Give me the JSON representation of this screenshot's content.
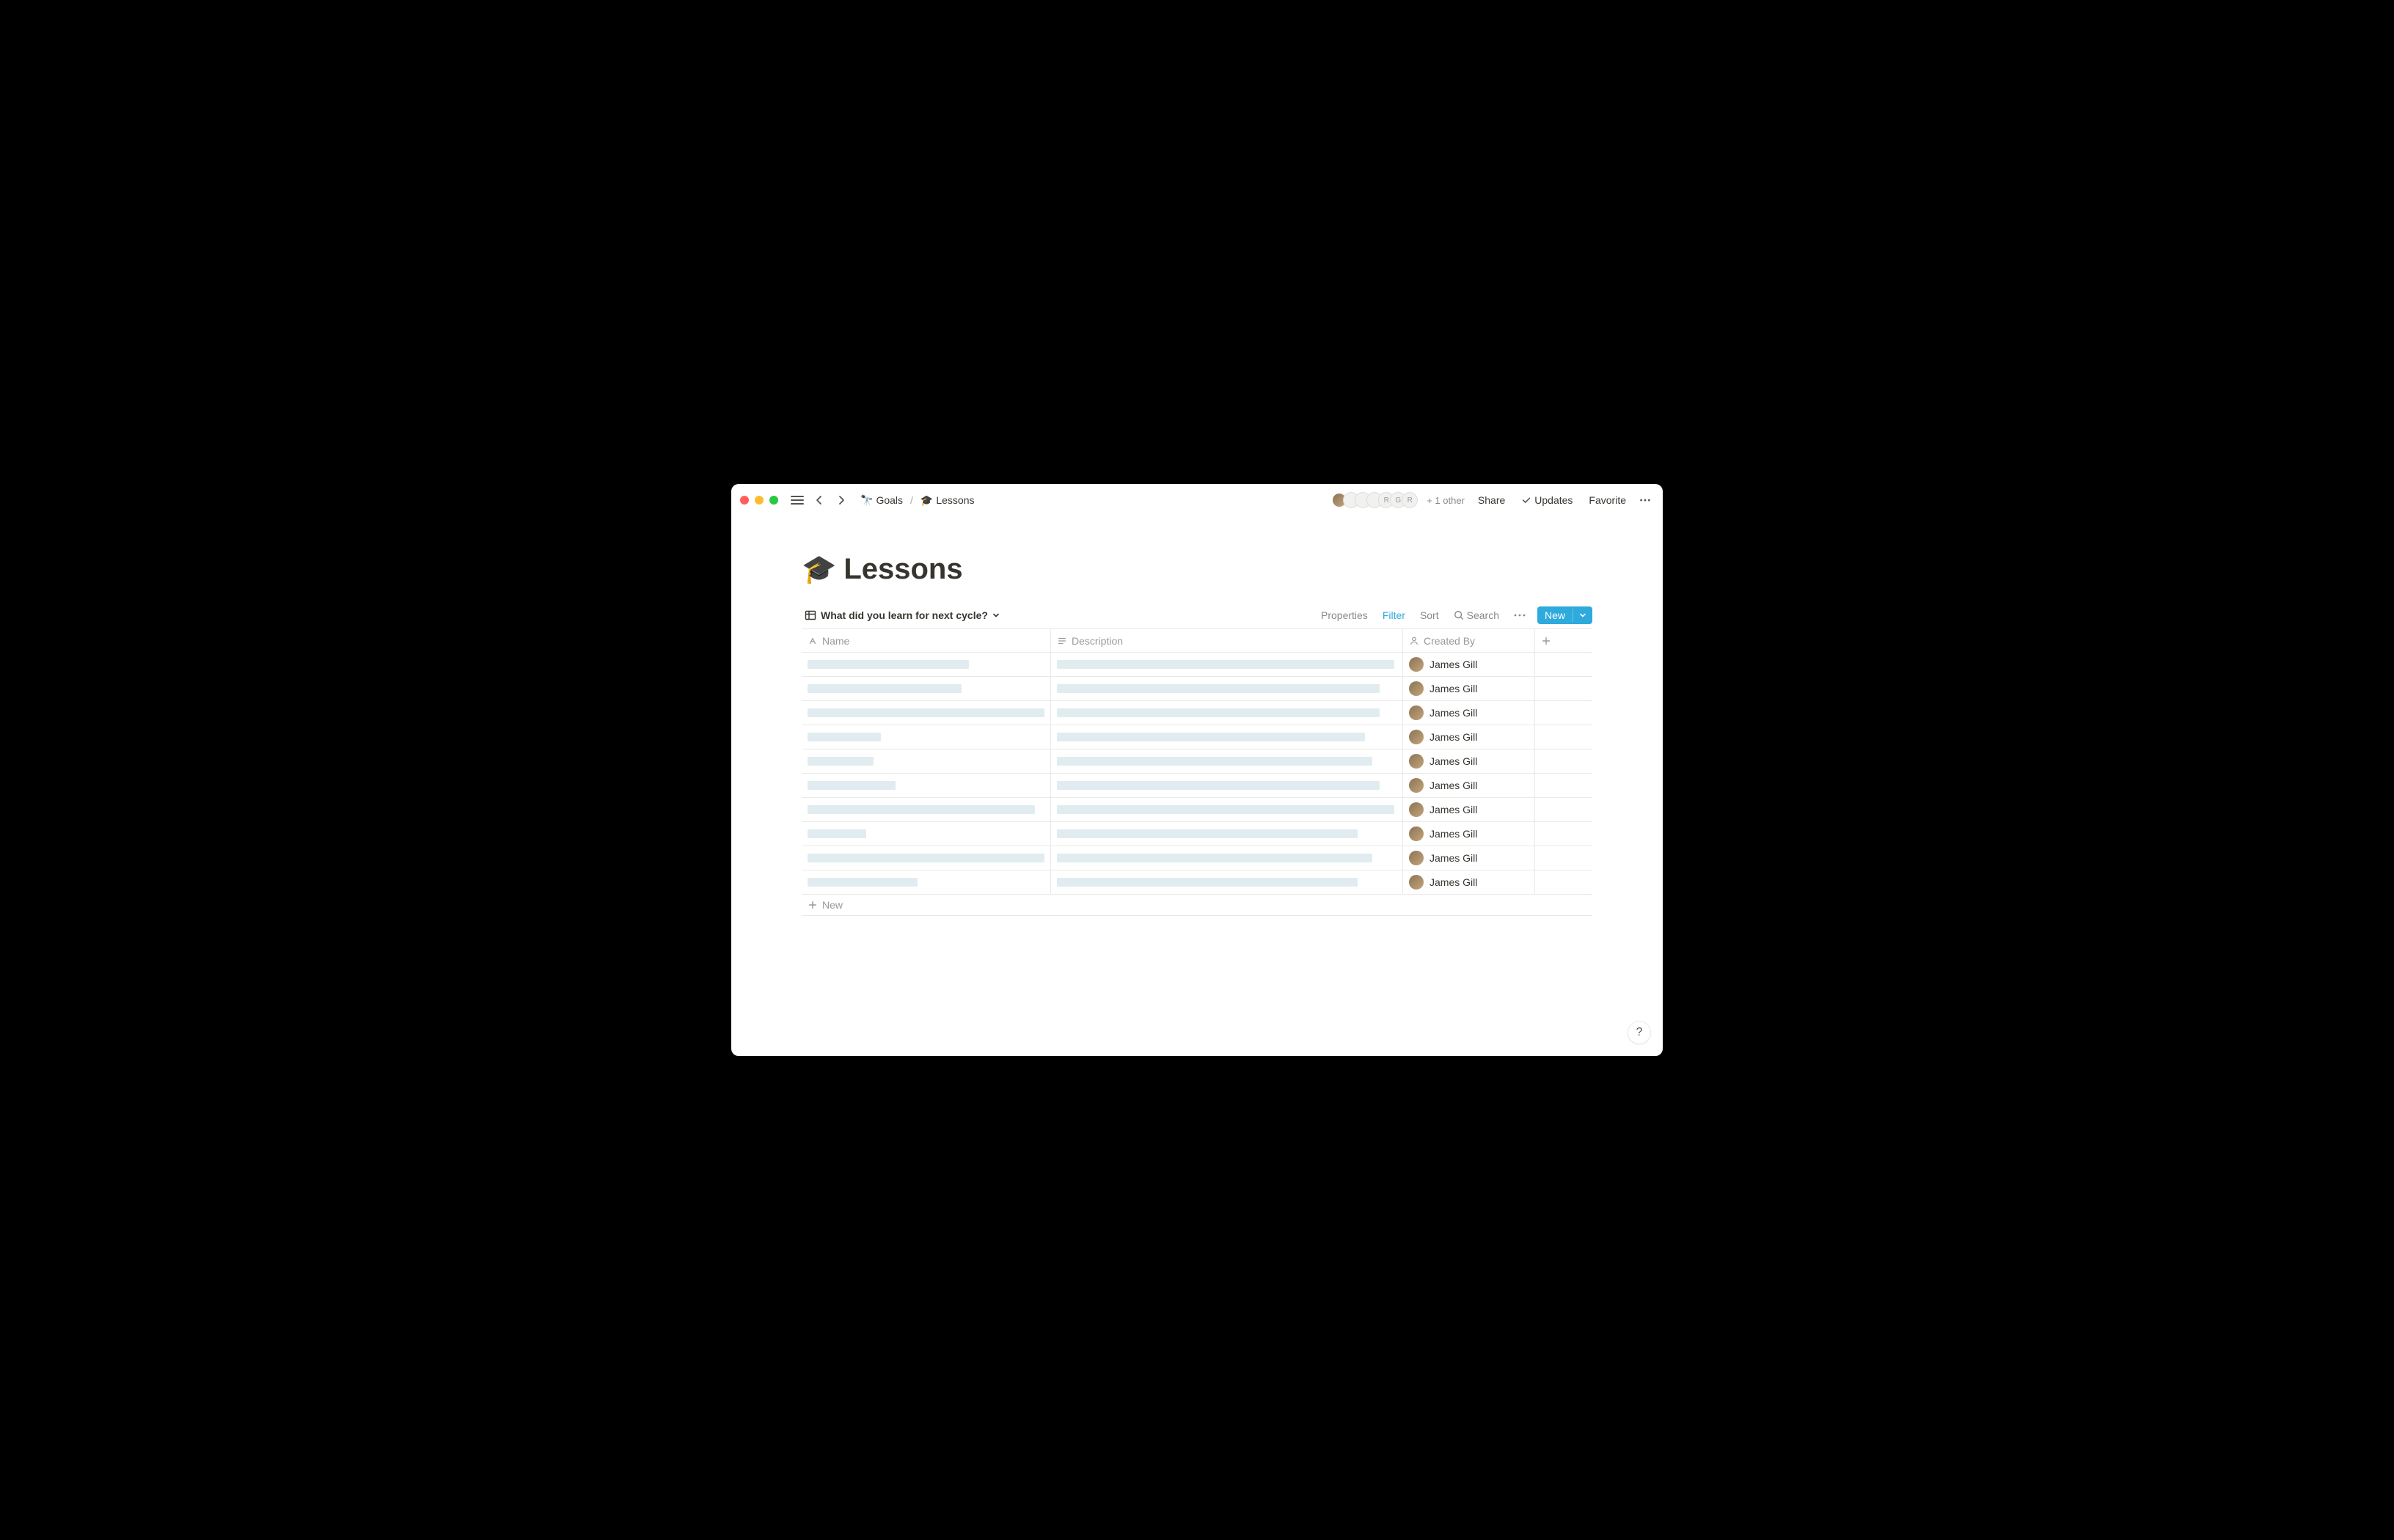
{
  "breadcrumb": {
    "parent_icon": "telescope",
    "parent_label": "Goals",
    "current_icon": "graduation-cap",
    "current_label": "Lessons"
  },
  "topbar": {
    "other_count": "+ 1 other",
    "share": "Share",
    "updates": "Updates",
    "favorite": "Favorite",
    "avatar_letters": [
      "R",
      "G",
      "R"
    ]
  },
  "page": {
    "emoji": "🎓",
    "title": "Lessons"
  },
  "view": {
    "name": "What did you learn for next cycle?",
    "properties": "Properties",
    "filter": "Filter",
    "sort": "Sort",
    "search": "Search",
    "new": "New"
  },
  "columns": {
    "name": "Name",
    "description": "Description",
    "created_by": "Created By"
  },
  "rows": [
    {
      "name_w": 220,
      "desc_w": 460,
      "creator": "James Gill"
    },
    {
      "name_w": 210,
      "desc_w": 440,
      "creator": "James Gill"
    },
    {
      "name_w": 330,
      "desc_w": 440,
      "creator": "James Gill"
    },
    {
      "name_w": 100,
      "desc_w": 420,
      "creator": "James Gill"
    },
    {
      "name_w": 90,
      "desc_w": 430,
      "creator": "James Gill"
    },
    {
      "name_w": 120,
      "desc_w": 440,
      "creator": "James Gill"
    },
    {
      "name_w": 310,
      "desc_w": 460,
      "creator": "James Gill"
    },
    {
      "name_w": 80,
      "desc_w": 410,
      "creator": "James Gill"
    },
    {
      "name_w": 335,
      "desc_w": 430,
      "creator": "James Gill"
    },
    {
      "name_w": 150,
      "desc_w": 410,
      "creator": "James Gill"
    }
  ],
  "new_row_label": "New",
  "help": "?"
}
